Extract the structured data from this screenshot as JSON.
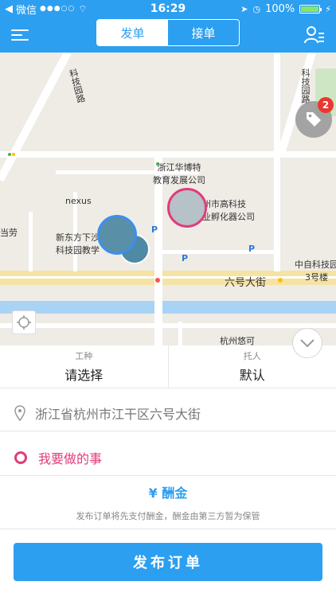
{
  "status_bar": {
    "carrier": "微信",
    "time": "16:29",
    "battery": "100%"
  },
  "nav": {
    "tabs": [
      {
        "label": "发单",
        "active": true
      },
      {
        "label": "接单",
        "active": false
      }
    ]
  },
  "map": {
    "labels": {
      "keji_road": "科技园路",
      "keji_road_right": "科技园路",
      "huabote": "浙江华博特\n教育发展公司",
      "nexus": "nexus",
      "xindongfang": "新东方下沙\n科技园教学",
      "gaokeji": "州市高科技\n业孵化器公司",
      "liuhao": "六号大街",
      "zhongzi": "中自科技园\n3号楼",
      "hangzhou_kj": "杭州悠可",
      "mcd": "当劳"
    },
    "coupon_badge": "2"
  },
  "form": {
    "work_type_caption": "工种",
    "work_type_value": "请选择",
    "entrust_caption": "托人",
    "entrust_value": "默认",
    "address": "浙江省杭州市江干区六号大街",
    "task_placeholder": "我要做的事",
    "reward_label": "¥ 酬金",
    "note": "发布订单将先支付酬金，酬金由第三方暂为保管",
    "submit_label": "发布订单"
  },
  "colors": {
    "primary": "#2c9ff0",
    "accent_pink": "#e23b7a",
    "badge_red": "#e8382f"
  }
}
